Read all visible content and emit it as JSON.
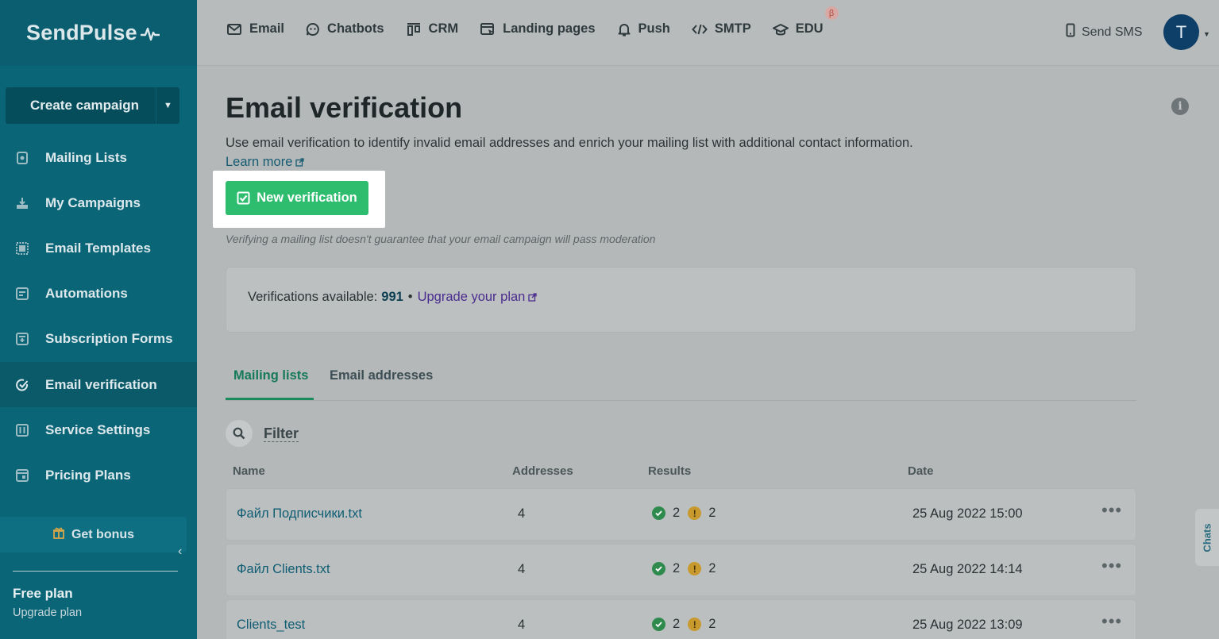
{
  "brand": {
    "name": "SendPulse"
  },
  "sidebar": {
    "create_label": "Create campaign",
    "items": [
      {
        "label": "Mailing Lists",
        "icon": "mailing-lists-icon"
      },
      {
        "label": "My Campaigns",
        "icon": "campaigns-icon"
      },
      {
        "label": "Email Templates",
        "icon": "templates-icon"
      },
      {
        "label": "Automations",
        "icon": "automations-icon"
      },
      {
        "label": "Subscription Forms",
        "icon": "forms-icon"
      },
      {
        "label": "Email verification",
        "icon": "verification-check-icon"
      },
      {
        "label": "Service Settings",
        "icon": "settings-sliders-icon"
      },
      {
        "label": "Pricing Plans",
        "icon": "pricing-icon"
      }
    ],
    "bonus_label": "Get bonus",
    "plan_title": "Free plan",
    "plan_link": "Upgrade plan"
  },
  "topnav": {
    "items": [
      {
        "label": "Email",
        "icon": "envelope-icon"
      },
      {
        "label": "Chatbots",
        "icon": "chatbot-icon"
      },
      {
        "label": "CRM",
        "icon": "crm-icon"
      },
      {
        "label": "Landing pages",
        "icon": "landing-icon"
      },
      {
        "label": "Push",
        "icon": "bell-icon"
      },
      {
        "label": "SMTP",
        "icon": "code-icon"
      },
      {
        "label": "EDU",
        "icon": "graduation-cap-icon"
      }
    ],
    "beta_badge": "β",
    "send_sms": "Send SMS",
    "avatar_letter": "T"
  },
  "main": {
    "title": "Email verification",
    "description": "Use email verification to identify invalid email addresses and enrich your mailing list with additional contact information.",
    "learn_more": "Learn more",
    "new_button": "New verification",
    "note": "Verifying a mailing list doesn't guarantee that your email campaign will pass moderation",
    "available_label": "Verifications available:",
    "available_count": "991",
    "separator": "•",
    "upgrade_link": "Upgrade your plan",
    "tabs": [
      "Mailing lists",
      "Email addresses"
    ],
    "filter_label": "Filter",
    "columns": [
      "Name",
      "Addresses",
      "Results",
      "Date"
    ],
    "rows": [
      {
        "name": "Файл Подписчики.txt",
        "addresses": "4",
        "valid": "2",
        "invalid": "2",
        "date": "25 Aug 2022 15:00"
      },
      {
        "name": "Файл Clients.txt",
        "addresses": "4",
        "valid": "2",
        "invalid": "2",
        "date": "25 Aug 2022 14:14"
      },
      {
        "name": "Clients_test",
        "addresses": "4",
        "valid": "2",
        "invalid": "2",
        "date": "25 Aug 2022 13:09"
      }
    ],
    "more_glyph": "•••",
    "chats_label": "Chats"
  },
  "colors": {
    "accent_green": "#2ebd6e",
    "sidebar": "#0a6577",
    "link": "#155c73"
  }
}
